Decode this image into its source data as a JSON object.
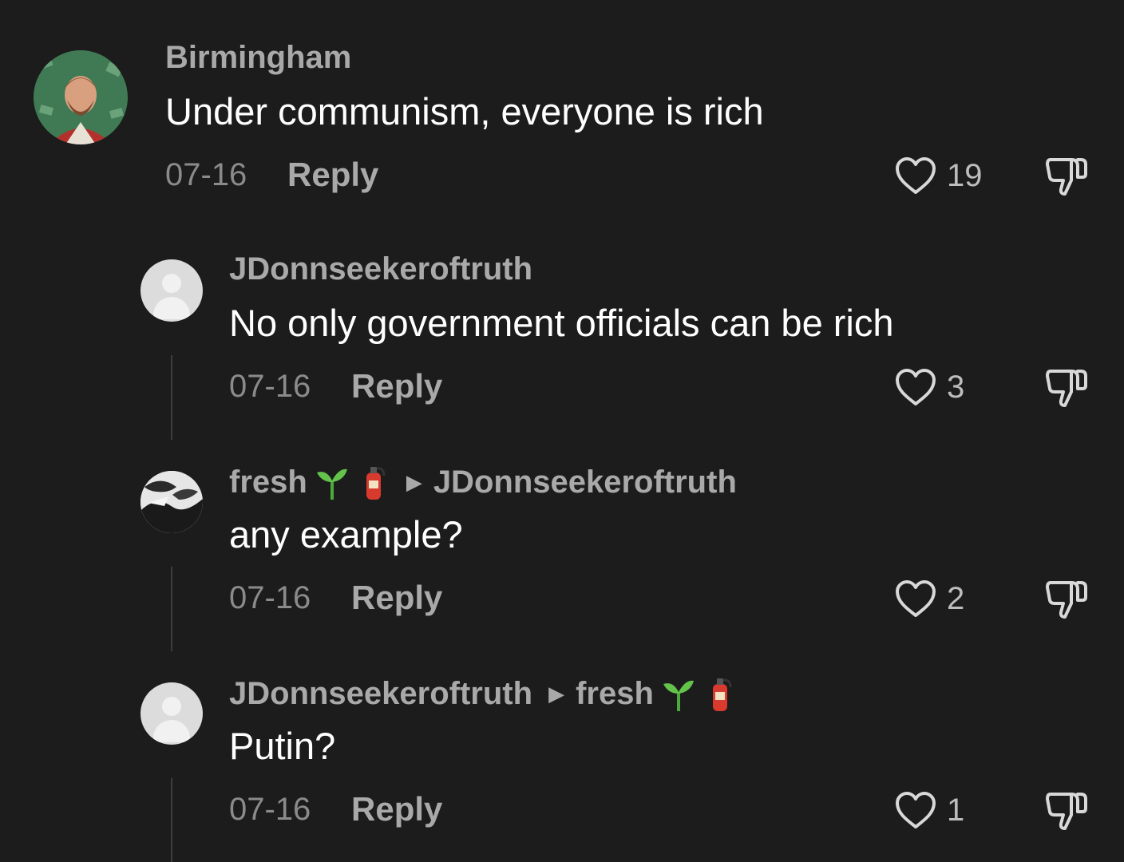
{
  "comments": [
    {
      "username": "Birmingham",
      "text": "Under communism, everyone is rich",
      "date": "07-16",
      "reply_label": "Reply",
      "likes": "19"
    },
    {
      "username": "JDonnseekeroftruth",
      "text": "No only government officials can be rich",
      "date": "07-16",
      "reply_label": "Reply",
      "likes": "3"
    },
    {
      "username": "fresh",
      "reply_to": "JDonnseekeroftruth",
      "text": "any example?",
      "date": "07-16",
      "reply_label": "Reply",
      "likes": "2"
    },
    {
      "username": "JDonnseekeroftruth",
      "reply_to": "fresh",
      "text": "Putin?",
      "date": "07-16",
      "reply_label": "Reply",
      "likes": "1"
    }
  ],
  "icons": {
    "like": "heart-outline-icon",
    "dislike": "thumbs-down-outline-icon",
    "reply_arrow": "triangle-right-icon",
    "emoji_1": "seedling-emoji",
    "emoji_2": "fire-extinguisher-emoji"
  },
  "colors": {
    "background": "#1c1c1c",
    "username": "#a9a9a9",
    "text": "#ffffff",
    "meta": "#8b8b8b"
  }
}
